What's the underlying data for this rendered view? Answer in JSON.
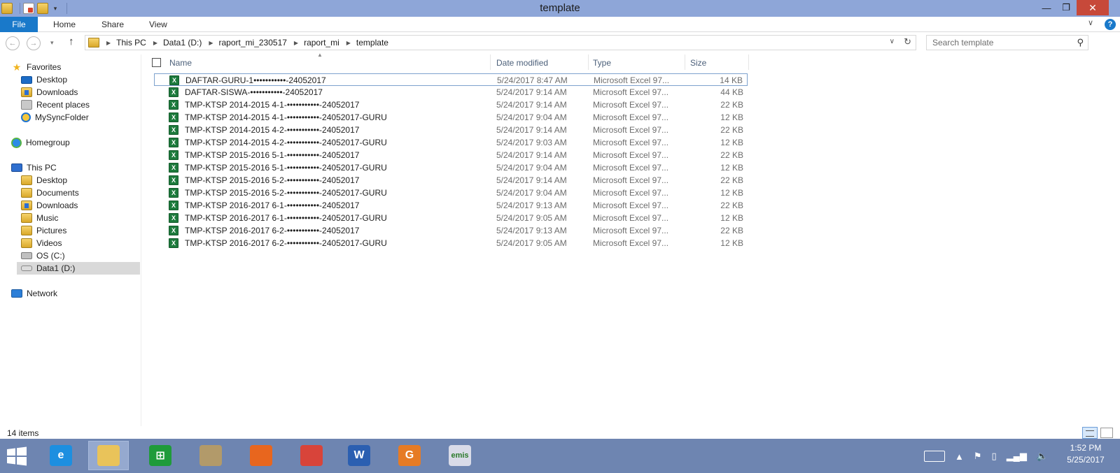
{
  "window": {
    "title": "template"
  },
  "ribbon": {
    "tabs": [
      "File",
      "Home",
      "Share",
      "View"
    ]
  },
  "address": {
    "crumbs": [
      "This PC",
      "Data1 (D:)",
      "raport_mi_230517",
      "raport_mi",
      "template"
    ],
    "search_placeholder": "Search template"
  },
  "nav": {
    "favorites": "Favorites",
    "fav_items": [
      "Desktop",
      "Downloads",
      "Recent places",
      "MySyncFolder"
    ],
    "homegroup": "Homegroup",
    "this_pc": "This PC",
    "pc_items": [
      "Desktop",
      "Documents",
      "Downloads",
      "Music",
      "Pictures",
      "Videos",
      "OS (C:)",
      "Data1 (D:)"
    ],
    "network": "Network"
  },
  "columns": {
    "name": "Name",
    "date": "Date modified",
    "type": "Type",
    "size": "Size"
  },
  "files": [
    {
      "name": "DAFTAR-GURU-1•••••••••••-24052017",
      "date": "5/24/2017 8:47 AM",
      "type": "Microsoft Excel 97...",
      "size": "14 KB"
    },
    {
      "name": "DAFTAR-SISWA-•••••••••••-24052017",
      "date": "5/24/2017 9:14 AM",
      "type": "Microsoft Excel 97...",
      "size": "44 KB"
    },
    {
      "name": "TMP-KTSP 2014-2015 4-1-•••••••••••-24052017",
      "date": "5/24/2017 9:14 AM",
      "type": "Microsoft Excel 97...",
      "size": "22 KB"
    },
    {
      "name": "TMP-KTSP 2014-2015 4-1-•••••••••••-24052017-GURU",
      "date": "5/24/2017 9:04 AM",
      "type": "Microsoft Excel 97...",
      "size": "12 KB"
    },
    {
      "name": "TMP-KTSP 2014-2015 4-2-•••••••••••-24052017",
      "date": "5/24/2017 9:14 AM",
      "type": "Microsoft Excel 97...",
      "size": "22 KB"
    },
    {
      "name": "TMP-KTSP 2014-2015 4-2-•••••••••••-24052017-GURU",
      "date": "5/24/2017 9:03 AM",
      "type": "Microsoft Excel 97...",
      "size": "12 KB"
    },
    {
      "name": "TMP-KTSP 2015-2016 5-1-•••••••••••-24052017",
      "date": "5/24/2017 9:14 AM",
      "type": "Microsoft Excel 97...",
      "size": "22 KB"
    },
    {
      "name": "TMP-KTSP 2015-2016 5-1-•••••••••••-24052017-GURU",
      "date": "5/24/2017 9:04 AM",
      "type": "Microsoft Excel 97...",
      "size": "12 KB"
    },
    {
      "name": "TMP-KTSP 2015-2016 5-2-•••••••••••-24052017",
      "date": "5/24/2017 9:14 AM",
      "type": "Microsoft Excel 97...",
      "size": "22 KB"
    },
    {
      "name": "TMP-KTSP 2015-2016 5-2-•••••••••••-24052017-GURU",
      "date": "5/24/2017 9:04 AM",
      "type": "Microsoft Excel 97...",
      "size": "12 KB"
    },
    {
      "name": "TMP-KTSP 2016-2017 6-1-•••••••••••-24052017",
      "date": "5/24/2017 9:13 AM",
      "type": "Microsoft Excel 97...",
      "size": "22 KB"
    },
    {
      "name": "TMP-KTSP 2016-2017 6-1-•••••••••••-24052017-GURU",
      "date": "5/24/2017 9:05 AM",
      "type": "Microsoft Excel 97...",
      "size": "12 KB"
    },
    {
      "name": "TMP-KTSP 2016-2017 6-2-•••••••••••-24052017",
      "date": "5/24/2017 9:13 AM",
      "type": "Microsoft Excel 97...",
      "size": "22 KB"
    },
    {
      "name": "TMP-KTSP 2016-2017 6-2-•••••••••••-24052017-GURU",
      "date": "5/24/2017 9:05 AM",
      "type": "Microsoft Excel 97...",
      "size": "12 KB"
    }
  ],
  "status": {
    "item_count": "14 items"
  },
  "taskbar": {
    "apps": [
      {
        "name": "internet-explorer",
        "label": "e",
        "color": "#1d8fe0"
      },
      {
        "name": "file-explorer",
        "label": "",
        "color": "#e9c35a",
        "active": true
      },
      {
        "name": "store",
        "label": "⊞",
        "color": "#1f9b3a"
      },
      {
        "name": "app-4",
        "label": "",
        "color": "#b29a6a"
      },
      {
        "name": "firefox",
        "label": "",
        "color": "#e8661e"
      },
      {
        "name": "chrome",
        "label": "",
        "color": "#d8443a"
      },
      {
        "name": "word",
        "label": "W",
        "color": "#2b5fb1"
      },
      {
        "name": "pdf-app",
        "label": "G",
        "color": "#e67b25"
      },
      {
        "name": "emis",
        "label": "emis",
        "color": "#d9dbe8"
      }
    ],
    "time": "1:52 PM",
    "date": "5/25/2017"
  },
  "colors": {
    "titlebar": "#8ea6d8",
    "file_tab": "#1979ca",
    "close": "#c7493a",
    "taskbar": "#6e85b1",
    "excel": "#1d7a3c"
  }
}
